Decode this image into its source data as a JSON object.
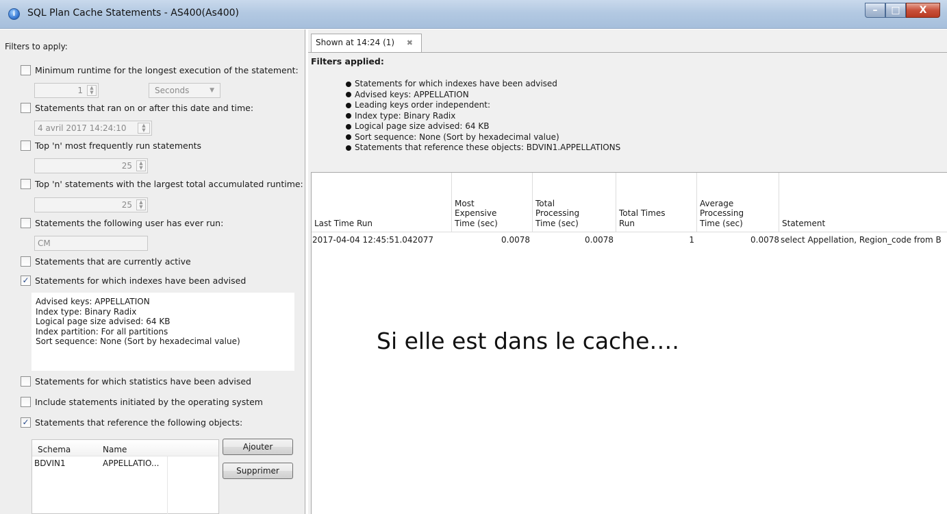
{
  "window": {
    "title": "SQL Plan Cache Statements - AS400(As400)",
    "icon": "app-icon",
    "controls": {
      "minimize": "–",
      "maximize": "□",
      "close": "X"
    }
  },
  "filters_panel": {
    "header": "Filters to apply:",
    "min_runtime": {
      "label": "Minimum runtime for the longest execution of the statement:",
      "checked": false,
      "value": "1",
      "unit": "Seconds"
    },
    "ran_after": {
      "label": "Statements that ran on or after this date and time:",
      "checked": false,
      "value": "4 avril 2017 14:24:10"
    },
    "top_frequent": {
      "label": "Top 'n' most frequently run statements",
      "checked": false,
      "value": "25"
    },
    "top_runtime": {
      "label": "Top 'n' statements with the largest total accumulated runtime:",
      "checked": false,
      "value": "25"
    },
    "user_ran": {
      "label": "Statements the following user has ever run:",
      "checked": false,
      "value": "CM"
    },
    "currently_active": {
      "label": "Statements that are currently active",
      "checked": false
    },
    "indexes_advised": {
      "label": "Statements for which indexes have been advised",
      "checked": true,
      "details": [
        "Advised keys: APPELLATION",
        "Index type: Binary Radix",
        "Logical page size advised: 64 KB",
        "Index partition: For all partitions",
        "Sort sequence: None (Sort by hexadecimal value)"
      ]
    },
    "statistics_advised": {
      "label": "Statements for which statistics have been advised",
      "checked": false
    },
    "include_os": {
      "label": "Include statements initiated by the operating system",
      "checked": false
    },
    "reference_objects": {
      "label": "Statements that reference the following objects:",
      "checked": true,
      "columns": [
        "Schema",
        "Name"
      ],
      "rows": [
        {
          "schema": "BDVIN1",
          "name": "APPELLATIO..."
        }
      ],
      "add_button": "Ajouter",
      "remove_button": "Supprimer"
    }
  },
  "results": {
    "tab": {
      "label": "Shown at 14:24 (1)",
      "close": "✖"
    },
    "filters_title": "Filters applied:",
    "filters_applied": [
      "Statements for which indexes have been advised",
      "Advised keys: APPELLATION",
      "Leading keys order independent:",
      "Index type: Binary Radix",
      "Logical page size advised: 64 KB",
      "Sort sequence: None (Sort by hexadecimal value)",
      "Statements that reference these objects: BDVIN1.APPELLATIONS"
    ],
    "table": {
      "columns": [
        [
          "Last Time Run"
        ],
        [
          "Most",
          "Expensive",
          "Time (sec)"
        ],
        [
          "Total",
          "Processing",
          "Time (sec)"
        ],
        [
          "Total Times",
          "Run"
        ],
        [
          "Average",
          "Processing",
          "Time (sec)"
        ],
        [
          "Statement"
        ]
      ],
      "rows": [
        {
          "last_time_run": "2017-04-04 12:45:51.042077",
          "most_expensive": "0.0078",
          "total_processing": "0.0078",
          "total_times_run": "1",
          "average_processing": "0.0078",
          "statement": "select Appellation, Region_code from B"
        }
      ]
    }
  },
  "annotation": "Si elle est dans le cache…."
}
